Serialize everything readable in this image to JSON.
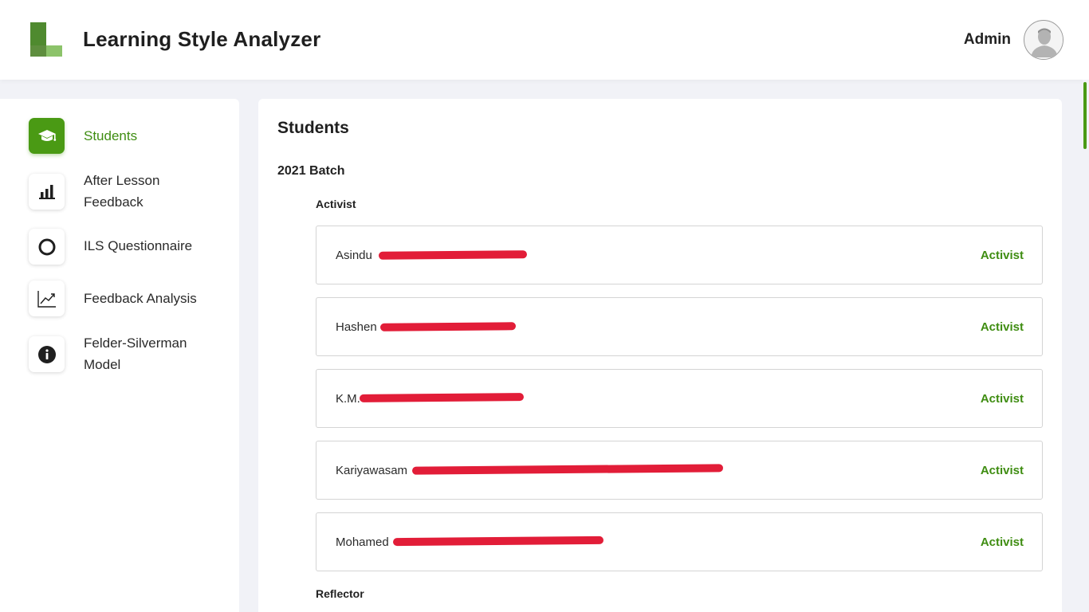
{
  "header": {
    "app_title": "Learning Style Analyzer",
    "user_name": "Admin",
    "logo_icon": "learning-style-analyzer-logo",
    "avatar_icon": "user-avatar"
  },
  "sidebar": {
    "items": [
      {
        "label": "Students",
        "icon": "graduation-cap-icon",
        "active": true
      },
      {
        "label": "After Lesson Feedback",
        "icon": "bar-chart-icon",
        "active": false
      },
      {
        "label": "ILS Questionnaire",
        "icon": "circle-icon",
        "active": false
      },
      {
        "label": "Feedback Analysis",
        "icon": "trend-line-icon",
        "active": false
      },
      {
        "label": "Felder-Silverman Model",
        "icon": "info-icon",
        "active": false
      }
    ]
  },
  "main": {
    "title": "Students",
    "batch": "2021 Batch",
    "groups": [
      {
        "title": "Activist",
        "students": [
          {
            "name": "Asindu",
            "style": "Activist"
          },
          {
            "name": "Hashen",
            "style": "Activist"
          },
          {
            "name": "K.M.",
            "style": "Activist"
          },
          {
            "name": "Kariyawasam",
            "style": "Activist"
          },
          {
            "name": "Mohamed",
            "style": "Activist"
          }
        ]
      },
      {
        "title": "Reflector",
        "students": []
      }
    ]
  },
  "colors": {
    "accent": "#4a9a14",
    "accent_text": "#3f8d12",
    "background": "#f1f2f7",
    "redaction": "#e21d38"
  }
}
